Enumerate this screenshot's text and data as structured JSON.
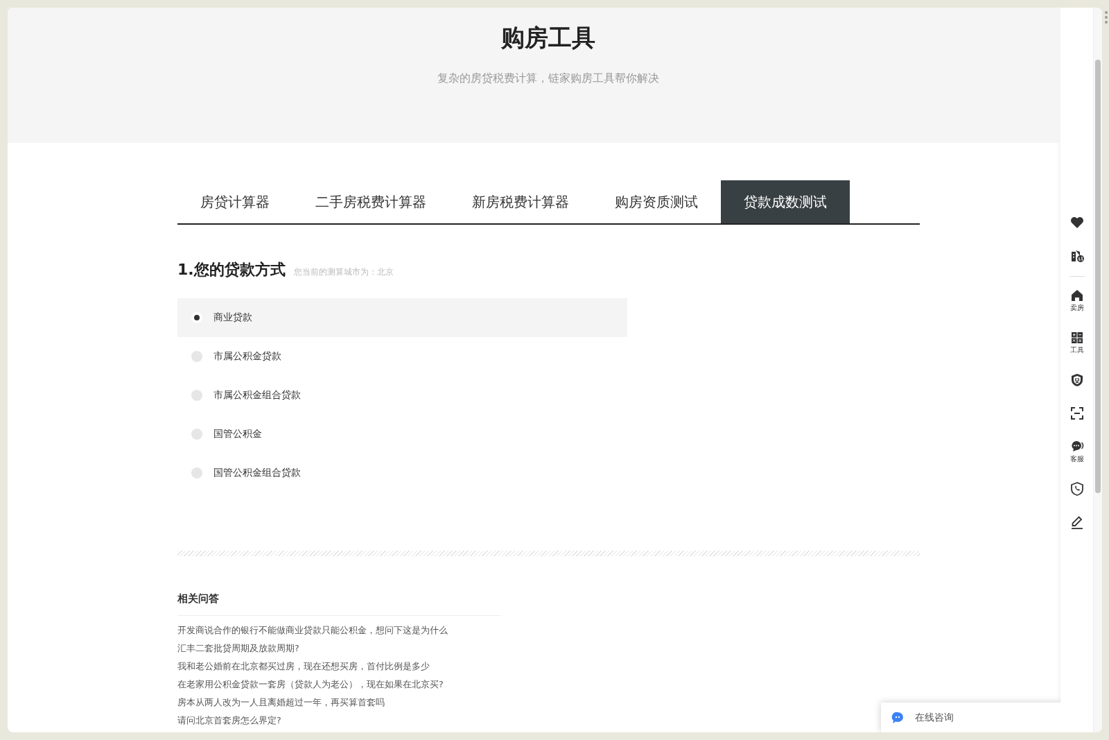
{
  "header": {
    "title": "购房工具",
    "subtitle": "复杂的房贷税费计算，链家购房工具帮你解决"
  },
  "tabs": [
    {
      "label": "房贷计算器",
      "selected": false
    },
    {
      "label": "二手房税费计算器",
      "selected": false
    },
    {
      "label": "新房税费计算器",
      "selected": false
    },
    {
      "label": "购房资质测试",
      "selected": false
    },
    {
      "label": "贷款成数测试",
      "selected": true
    }
  ],
  "question": {
    "title": "1.您的贷款方式",
    "note": "您当前的测算城市为：北京",
    "options": [
      {
        "label": "商业贷款",
        "selected": true
      },
      {
        "label": "市属公积金贷款",
        "selected": false
      },
      {
        "label": "市属公积金组合贷款",
        "selected": false
      },
      {
        "label": "国管公积金",
        "selected": false
      },
      {
        "label": "国管公积金组合贷款",
        "selected": false
      }
    ]
  },
  "related": {
    "title": "相关问答",
    "questions": [
      "开发商说合作的银行不能做商业贷款只能公积金，想问下这是为什么",
      "汇丰二套批贷周期及放款周期?",
      "我和老公婚前在北京都买过房，现在还想买房，首付比例是多少",
      "在老家用公积金贷款一套房（贷款人为老公），现在如果在北京买?",
      "房本从两人改为一人且离婚超过一年，再买算首套吗",
      "请问北京首套房怎么界定?"
    ]
  },
  "sidebar": {
    "top_items": [
      {
        "kind": "heart"
      },
      {
        "kind": "compare"
      }
    ],
    "items": [
      {
        "kind": "home",
        "label": "卖房"
      },
      {
        "kind": "tools",
        "label": "工具"
      },
      {
        "kind": "shield"
      },
      {
        "kind": "scan"
      },
      {
        "kind": "service",
        "label": "客服"
      },
      {
        "kind": "phone"
      },
      {
        "kind": "edit"
      }
    ]
  },
  "chat": {
    "label": "在线咨询"
  }
}
